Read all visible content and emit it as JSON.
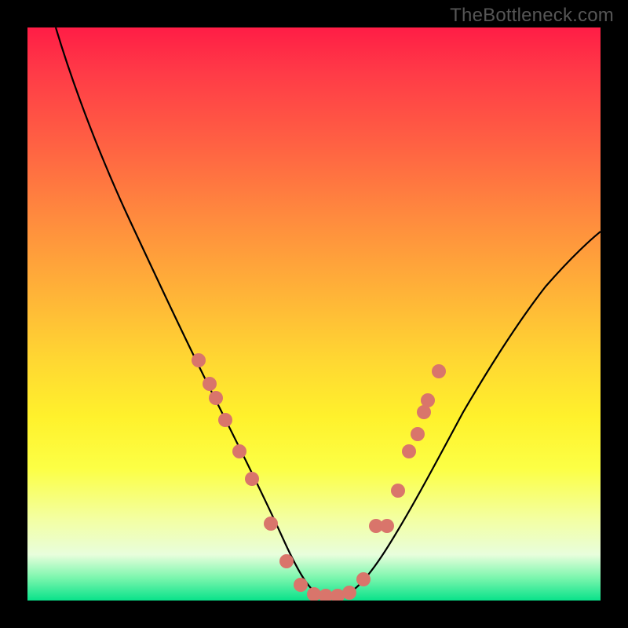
{
  "watermark": "TheBottleneck.com",
  "colors": {
    "page_bg": "#000000",
    "dot": "#d9756b",
    "curve": "#000000"
  },
  "chart_data": {
    "type": "line",
    "title": "",
    "xlabel": "",
    "ylabel": "",
    "xlim": [
      0,
      100
    ],
    "ylim": [
      0,
      100
    ],
    "grid": false,
    "legend": false,
    "series": [
      {
        "name": "curve",
        "x": [
          5,
          8,
          12,
          16,
          20,
          24,
          28,
          30,
          33,
          36,
          39,
          42,
          45,
          47,
          49,
          51,
          53,
          56,
          60,
          64,
          68,
          72,
          76,
          80,
          84,
          88,
          92,
          96,
          100
        ],
        "y": [
          100,
          92,
          82,
          72,
          63,
          54,
          46,
          42,
          36,
          30,
          24,
          17,
          10,
          5,
          2,
          1,
          1,
          2,
          5,
          11,
          18,
          25,
          32,
          38,
          44,
          49,
          54,
          58,
          62
        ]
      }
    ],
    "markers": [
      {
        "x": 30,
        "y": 42
      },
      {
        "x": 32.5,
        "y": 37
      },
      {
        "x": 33.5,
        "y": 35
      },
      {
        "x": 35.5,
        "y": 30.5
      },
      {
        "x": 38,
        "y": 24
      },
      {
        "x": 40.5,
        "y": 19
      },
      {
        "x": 44,
        "y": 12
      },
      {
        "x": 47,
        "y": 5
      },
      {
        "x": 49,
        "y": 2
      },
      {
        "x": 51,
        "y": 1
      },
      {
        "x": 53,
        "y": 1
      },
      {
        "x": 55,
        "y": 1.5
      },
      {
        "x": 57,
        "y": 3
      },
      {
        "x": 59.5,
        "y": 5
      },
      {
        "x": 61.5,
        "y": 13
      },
      {
        "x": 63.5,
        "y": 13
      },
      {
        "x": 65,
        "y": 19
      },
      {
        "x": 67,
        "y": 26
      },
      {
        "x": 68.5,
        "y": 29
      },
      {
        "x": 69.5,
        "y": 33
      },
      {
        "x": 70,
        "y": 35
      },
      {
        "x": 72,
        "y": 40
      }
    ],
    "background_gradient": {
      "type": "vertical",
      "stops": [
        {
          "pos": 0,
          "color": "#ff1d46"
        },
        {
          "pos": 50,
          "color": "#ffd732"
        },
        {
          "pos": 100,
          "color": "#09e28a"
        }
      ]
    }
  }
}
